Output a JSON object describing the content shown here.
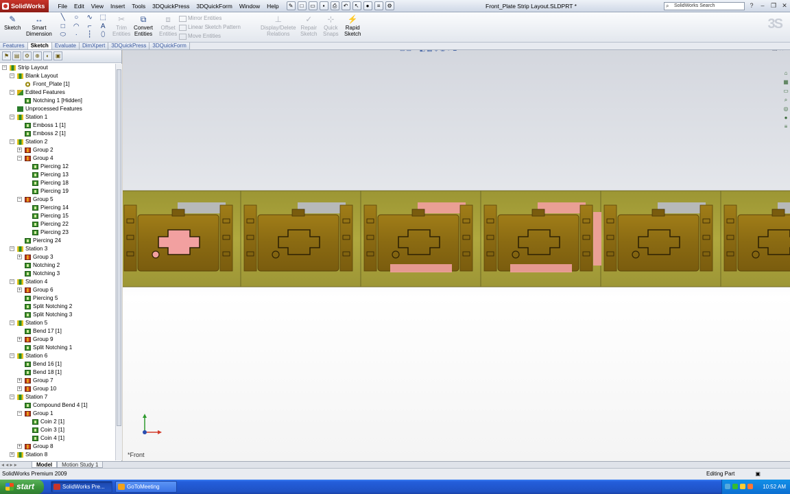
{
  "app": {
    "logo_text": "SolidWorks",
    "document_title": "Front_Plate Strip Layout.SLDPRT *",
    "search_placeholder": "SolidWorks Search"
  },
  "menu": [
    "File",
    "Edit",
    "View",
    "Insert",
    "Tools",
    "3DQuickPress",
    "3DQuickForm",
    "Window",
    "Help"
  ],
  "commands": {
    "sketch": "Sketch",
    "smart_dimension_1": "Smart",
    "smart_dimension_2": "Dimension",
    "trim_1": "Trim",
    "trim_2": "Entities",
    "convert_1": "Convert",
    "convert_2": "Entities",
    "offset_1": "Offset",
    "offset_2": "Entities",
    "mirror": "Mirror Entities",
    "linear_pattern": "Linear Sketch Pattern",
    "move": "Move Entities",
    "display_delete_1": "Display/Delete",
    "display_delete_2": "Relations",
    "repair_1": "Repair",
    "repair_2": "Sketch",
    "quick_snaps_1": "Quick",
    "quick_snaps_2": "Snaps",
    "rapid_1": "Rapid",
    "rapid_2": "Sketch"
  },
  "tabs": [
    "Features",
    "Sketch",
    "Evaluate",
    "DimXpert",
    "3DQuickPress",
    "3DQuickForm"
  ],
  "active_tab": "Sketch",
  "tree": [
    {
      "label": "Strip Layout",
      "level": 0,
      "exp": "-",
      "icon": "station"
    },
    {
      "label": "Blank Layout",
      "level": 1,
      "exp": "-",
      "icon": "station"
    },
    {
      "label": "Front_Plate [1]",
      "level": 2,
      "exp": "",
      "icon": "eye"
    },
    {
      "label": "Edited Features",
      "level": 1,
      "exp": "-",
      "icon": "edit"
    },
    {
      "label": "Notching 1 [Hidden]",
      "level": 2,
      "exp": "",
      "icon": "feat"
    },
    {
      "label": "Unprocessed Features",
      "level": 1,
      "exp": "",
      "icon": "unproc"
    },
    {
      "label": "Station 1",
      "level": 1,
      "exp": "-",
      "icon": "station"
    },
    {
      "label": "Emboss 1 [1]",
      "level": 2,
      "exp": "",
      "icon": "feat"
    },
    {
      "label": "Emboss 2 [1]",
      "level": 2,
      "exp": "",
      "icon": "feat"
    },
    {
      "label": "Station 2",
      "level": 1,
      "exp": "-",
      "icon": "station"
    },
    {
      "label": "Group 2",
      "level": 2,
      "exp": "+",
      "icon": "group"
    },
    {
      "label": "Group 4",
      "level": 2,
      "exp": "-",
      "icon": "group"
    },
    {
      "label": "Piercing 12",
      "level": 3,
      "exp": "",
      "icon": "feat"
    },
    {
      "label": "Piercing 13",
      "level": 3,
      "exp": "",
      "icon": "feat"
    },
    {
      "label": "Piercing 18",
      "level": 3,
      "exp": "",
      "icon": "feat"
    },
    {
      "label": "Piercing 19",
      "level": 3,
      "exp": "",
      "icon": "feat"
    },
    {
      "label": "Group 5",
      "level": 2,
      "exp": "-",
      "icon": "group"
    },
    {
      "label": "Piercing 14",
      "level": 3,
      "exp": "",
      "icon": "feat"
    },
    {
      "label": "Piercing 15",
      "level": 3,
      "exp": "",
      "icon": "feat"
    },
    {
      "label": "Piercing 22",
      "level": 3,
      "exp": "",
      "icon": "feat"
    },
    {
      "label": "Piercing 23",
      "level": 3,
      "exp": "",
      "icon": "feat"
    },
    {
      "label": "Piercing 24",
      "level": 2,
      "exp": "",
      "icon": "feat"
    },
    {
      "label": "Station 3",
      "level": 1,
      "exp": "-",
      "icon": "station"
    },
    {
      "label": "Group 3",
      "level": 2,
      "exp": "+",
      "icon": "group"
    },
    {
      "label": "Notching 2",
      "level": 2,
      "exp": "",
      "icon": "feat"
    },
    {
      "label": "Notching 3",
      "level": 2,
      "exp": "",
      "icon": "feat"
    },
    {
      "label": "Station 4",
      "level": 1,
      "exp": "-",
      "icon": "station"
    },
    {
      "label": "Group 6",
      "level": 2,
      "exp": "+",
      "icon": "group"
    },
    {
      "label": "Piercing 5",
      "level": 2,
      "exp": "",
      "icon": "feat"
    },
    {
      "label": "Split Notching 2",
      "level": 2,
      "exp": "",
      "icon": "feat"
    },
    {
      "label": "Split Notching 3",
      "level": 2,
      "exp": "",
      "icon": "feat"
    },
    {
      "label": "Station 5",
      "level": 1,
      "exp": "-",
      "icon": "station"
    },
    {
      "label": "Bend 17 [1]",
      "level": 2,
      "exp": "",
      "icon": "feat"
    },
    {
      "label": "Group 9",
      "level": 2,
      "exp": "+",
      "icon": "group"
    },
    {
      "label": "Split Notching 1",
      "level": 2,
      "exp": "",
      "icon": "feat"
    },
    {
      "label": "Station 6",
      "level": 1,
      "exp": "-",
      "icon": "station"
    },
    {
      "label": "Bend 16 [1]",
      "level": 2,
      "exp": "",
      "icon": "feat"
    },
    {
      "label": "Bend 18 [1]",
      "level": 2,
      "exp": "",
      "icon": "feat"
    },
    {
      "label": "Group 7",
      "level": 2,
      "exp": "+",
      "icon": "group"
    },
    {
      "label": "Group 10",
      "level": 2,
      "exp": "+",
      "icon": "group"
    },
    {
      "label": "Station 7",
      "level": 1,
      "exp": "-",
      "icon": "station"
    },
    {
      "label": "Compound Bend 4 [1]",
      "level": 2,
      "exp": "",
      "icon": "feat"
    },
    {
      "label": "Group 1",
      "level": 2,
      "exp": "-",
      "icon": "group"
    },
    {
      "label": "Coin 2 [1]",
      "level": 3,
      "exp": "",
      "icon": "feat"
    },
    {
      "label": "Coin 3 [1]",
      "level": 3,
      "exp": "",
      "icon": "feat"
    },
    {
      "label": "Coin 4 [1]",
      "level": 3,
      "exp": "",
      "icon": "feat"
    },
    {
      "label": "Group 8",
      "level": 2,
      "exp": "+",
      "icon": "group"
    },
    {
      "label": "Station 8",
      "level": 1,
      "exp": "+",
      "icon": "station"
    }
  ],
  "graphics": {
    "view_label": "*Front",
    "colors": {
      "strip": "#ada43a",
      "part": "#8a6c14",
      "highlight": "#f2a0a0",
      "slot": "#b9bcc8"
    }
  },
  "bottom_tabs": [
    "Model",
    "Motion Study 1"
  ],
  "status": {
    "left": "SolidWorks Premium 2009",
    "mode": "Editing Part"
  },
  "taskbar": {
    "start": "start",
    "tasks": [
      "SolidWorks Pre...",
      "GoToMeeting"
    ],
    "clock": "10:52 AM"
  }
}
